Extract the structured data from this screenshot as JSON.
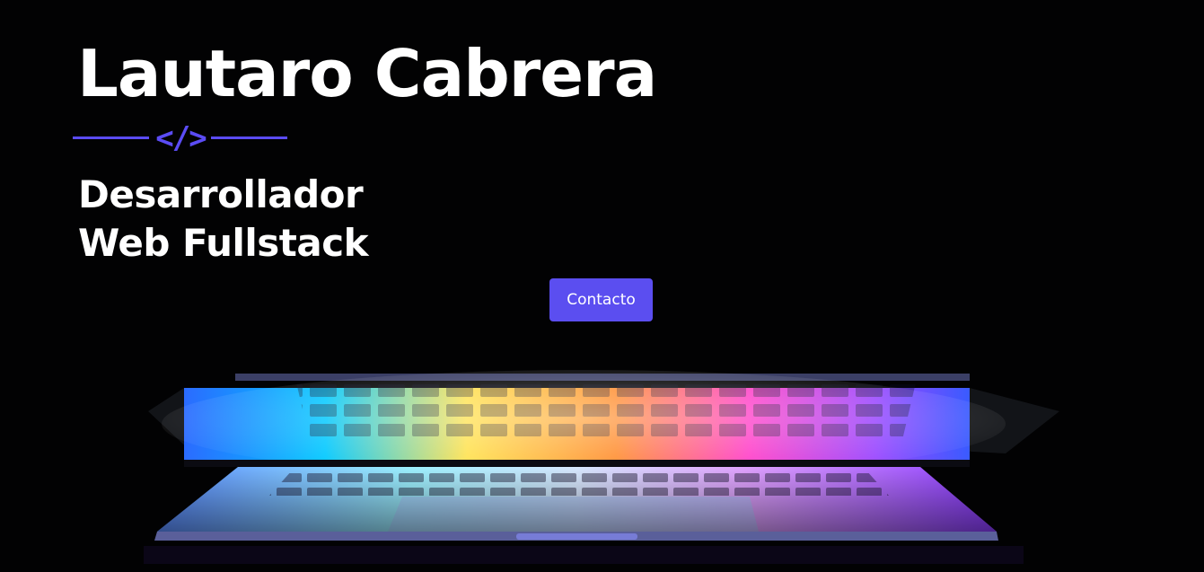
{
  "hero": {
    "name": "Lautaro Cabrera",
    "code_icon": "</>",
    "subtitle_line1": "Desarrollador",
    "subtitle_line2": "Web Fullstack",
    "cta_label": "Contacto"
  },
  "colors": {
    "accent": "#5b4cf5",
    "background": "#000000",
    "text": "#ffffff"
  },
  "icons": {
    "divider": "code-brackets-icon"
  }
}
